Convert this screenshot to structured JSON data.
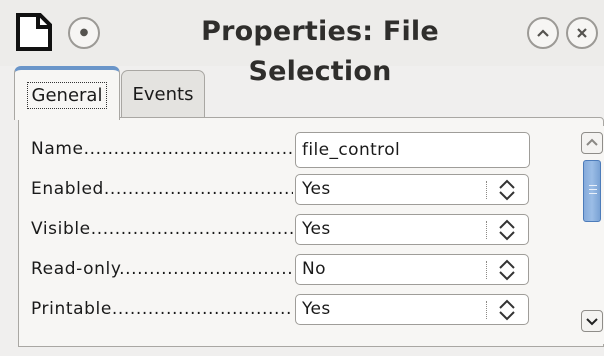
{
  "window": {
    "title": "Properties: File Selection",
    "icons": {
      "app": "document-icon",
      "menu": "window-menu-icon",
      "shade": "shade-up-icon",
      "close": "close-icon"
    }
  },
  "tabs": [
    {
      "label": "General",
      "selected": true
    },
    {
      "label": "Events",
      "selected": false
    }
  ],
  "properties": [
    {
      "label": "Name",
      "value": "file_control",
      "kind": "text"
    },
    {
      "label": "Enabled",
      "value": "Yes",
      "kind": "select"
    },
    {
      "label": "Visible",
      "value": "Yes",
      "kind": "select"
    },
    {
      "label": "Read-only",
      "value": "No",
      "kind": "select"
    },
    {
      "label": "Printable",
      "value": "Yes",
      "kind": "select"
    }
  ],
  "colors": {
    "active_tab_accent": "#6a95c9",
    "scroll_thumb": "#86abdb"
  }
}
